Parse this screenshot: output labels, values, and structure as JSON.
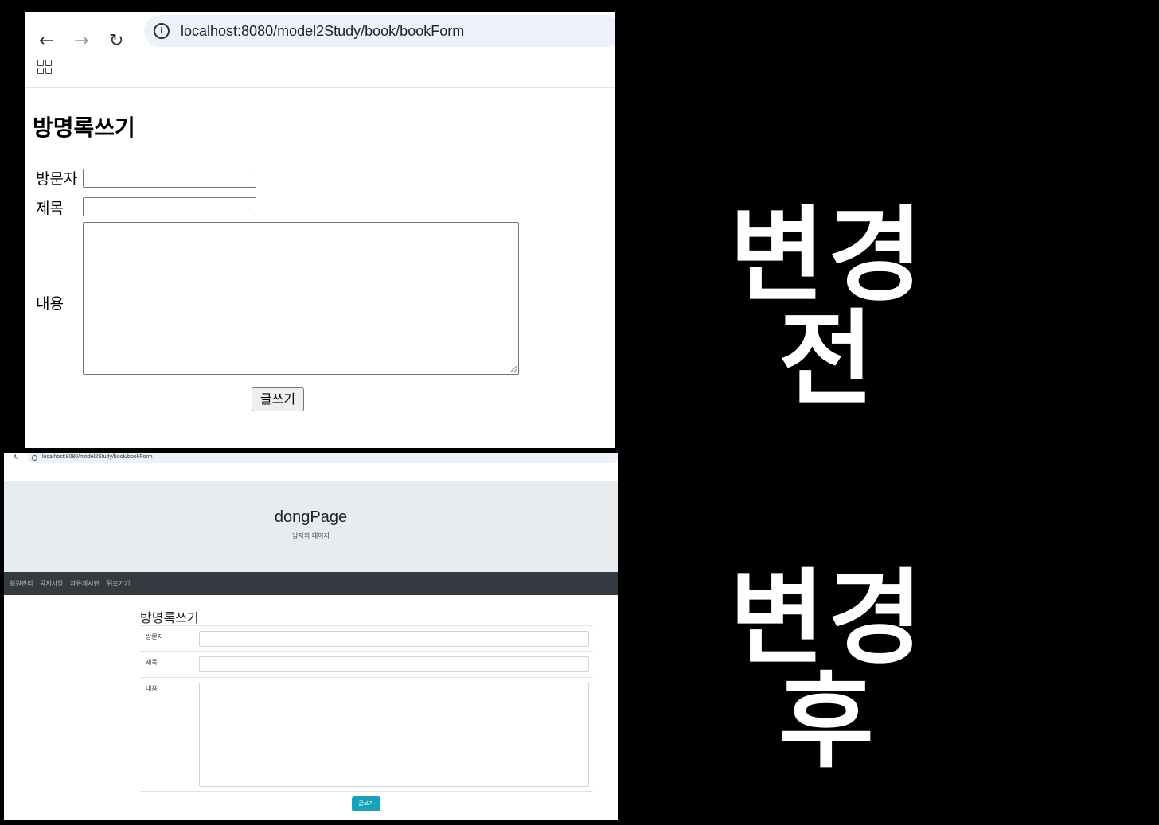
{
  "before": {
    "browser": {
      "url": "localhost:8080/model2Study/book/bookForm",
      "back_icon": "←",
      "forward_icon": "→",
      "reload_icon": "↻",
      "info_icon": "i"
    },
    "form": {
      "title": "방명록쓰기",
      "visitor_label": "방문자",
      "subject_label": "제목",
      "content_label": "내용",
      "visitor_value": "",
      "subject_value": "",
      "content_value": "",
      "submit_label": "글쓰기"
    }
  },
  "after": {
    "browser": {
      "url": "localhost:8080/model2Study/book/bookForm",
      "reload_icon": "↻"
    },
    "header": {
      "brand": "dongPage",
      "slogan": "남자의 페이지"
    },
    "navbar": {
      "items": [
        "회원관리",
        "공지사항",
        "자유게시판",
        "뒤로가기"
      ]
    },
    "form": {
      "title": "방명록쓰기",
      "visitor_label": "방문자",
      "subject_label": "제목",
      "content_label": "내용",
      "visitor_value": "",
      "subject_value": "",
      "content_value": "",
      "submit_label": "글쓰기"
    },
    "colors": {
      "jumbotron": "#e9ecef",
      "navbar": "#343a40",
      "button": "#17a2b8"
    }
  },
  "captions": {
    "before": "변경 전",
    "after": "변경 후"
  }
}
